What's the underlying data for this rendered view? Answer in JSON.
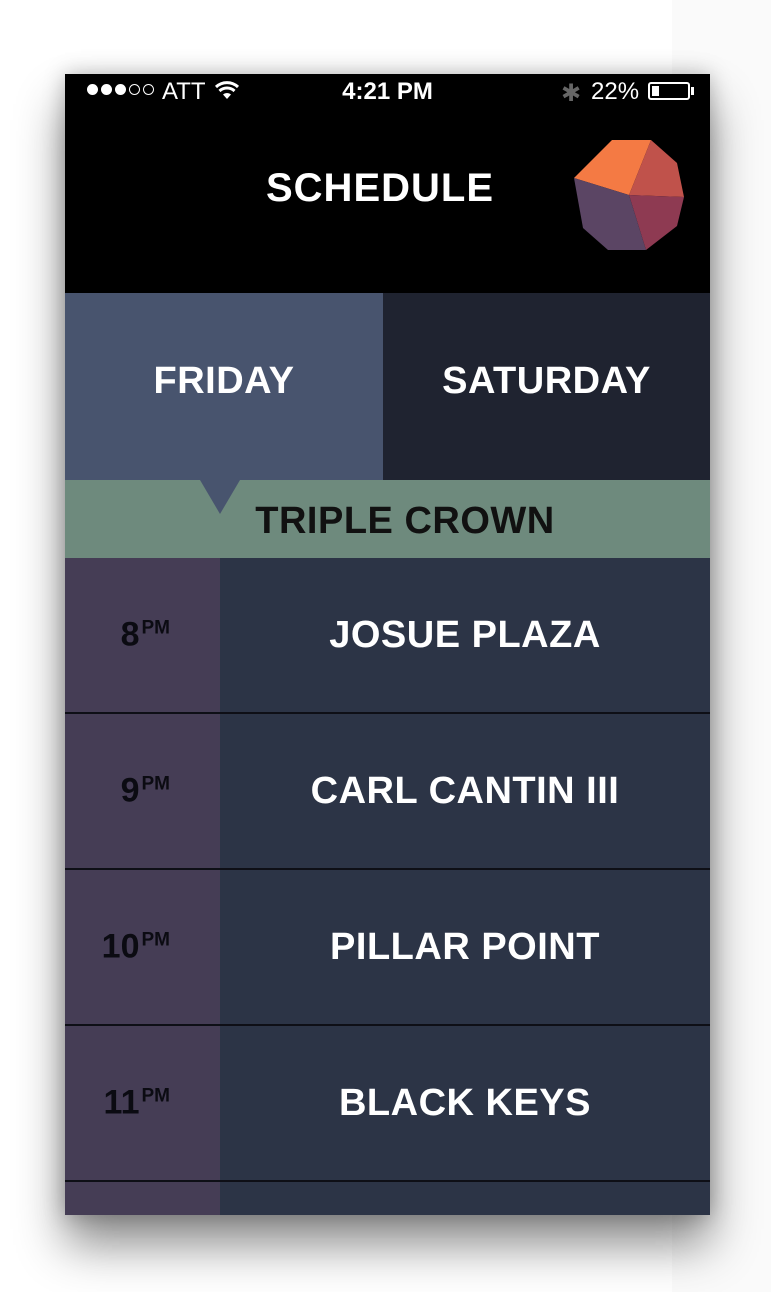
{
  "status_bar": {
    "signal_dots_filled": 3,
    "signal_dots_total": 5,
    "carrier": "ATT",
    "time": "4:21 PM",
    "battery_percent_label": "22%",
    "battery_level": 0.22
  },
  "header": {
    "title": "SCHEDULE",
    "logo_colors": [
      "#f47a44",
      "#c0524b",
      "#8e3a52",
      "#5b4564"
    ]
  },
  "tabs": [
    {
      "label": "FRIDAY",
      "selected": true
    },
    {
      "label": "SATURDAY",
      "selected": false
    }
  ],
  "stage": {
    "name": "TRIPLE CROWN"
  },
  "schedule": [
    {
      "hour": "8",
      "suffix": "PM",
      "act": "JOSUE PLAZA"
    },
    {
      "hour": "9",
      "suffix": "PM",
      "act": "CARL CANTIN III"
    },
    {
      "hour": "10",
      "suffix": "PM",
      "act": "PILLAR POINT"
    },
    {
      "hour": "11",
      "suffix": "PM",
      "act": "BLACK KEYS"
    }
  ],
  "colors": {
    "tab_selected": "#48546e",
    "tab_unselected": "#1f2330",
    "stage_banner": "#6e8a7d",
    "time_column": "#453d55",
    "act_column": "#2c3446"
  }
}
